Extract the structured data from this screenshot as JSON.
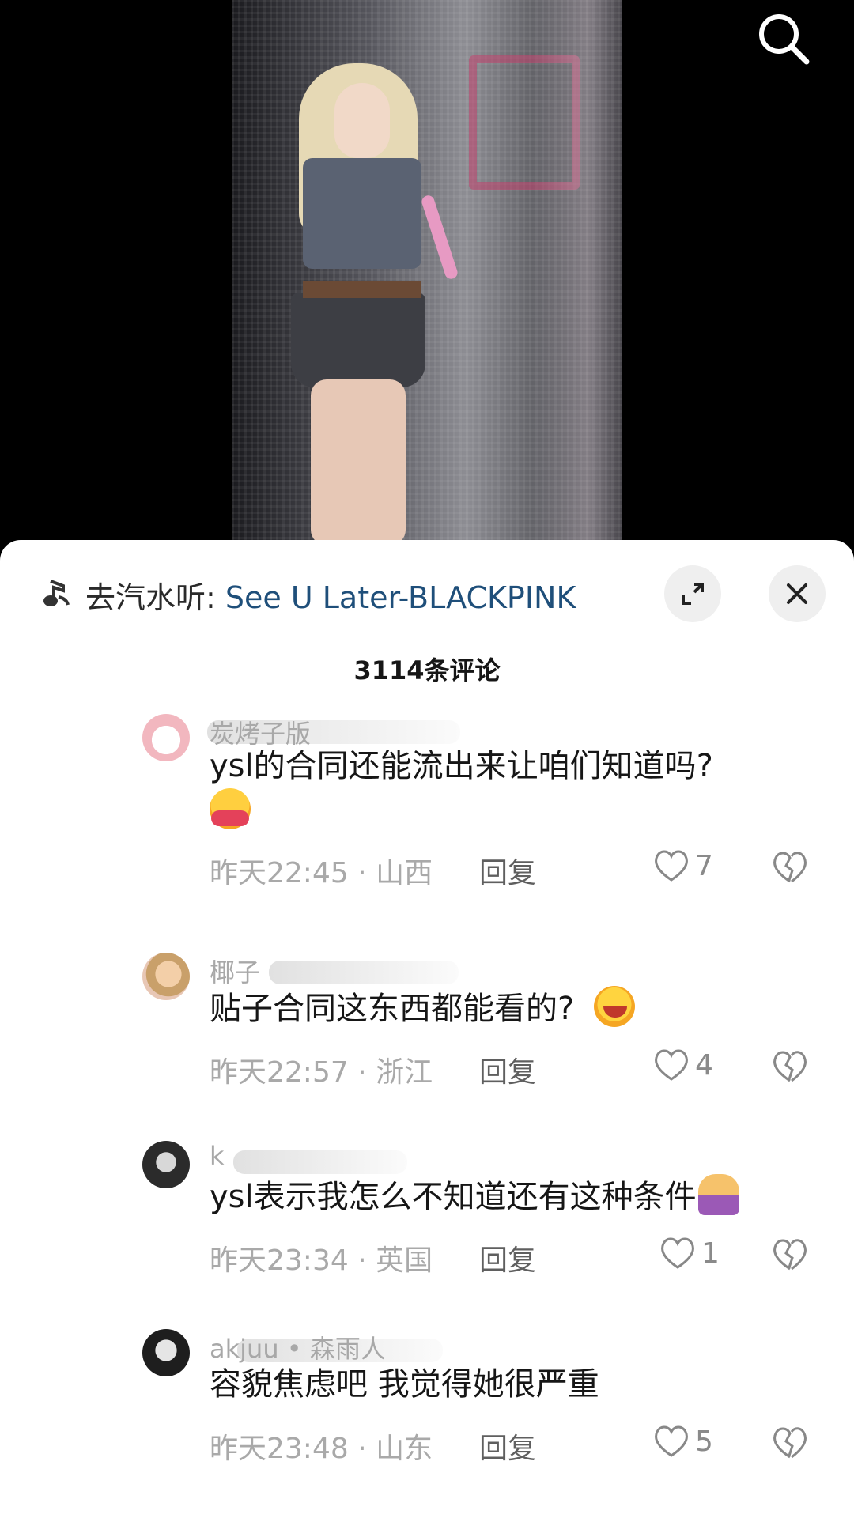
{
  "music": {
    "prefix": "去汽水听: ",
    "song": "See U Later-BLACKPINK"
  },
  "comments_count": "3114条评论",
  "comments": [
    {
      "username": "炭烤子版",
      "text_line1": "ysl的合同还能流出来让咱们知道吗?",
      "emoji": "hugging-face",
      "time_location": "昨天22:45 · 山西",
      "reply": "回复",
      "likes": "7"
    },
    {
      "username": "椰子",
      "text_line1": "贴子合同这东西都能看的?",
      "emoji": "rolling-laughing-face",
      "time_location": "昨天22:57 · 浙江",
      "reply": "回复",
      "likes": "4"
    },
    {
      "username": "k",
      "text_line1": "ysl表示我怎么不知道还有这种条件",
      "emoji": "person-shrugging",
      "time_location": "昨天23:34 · 英国",
      "reply": "回复",
      "likes": "1"
    },
    {
      "username": "akjuu • 森雨人",
      "text_line1": "容貌焦虑吧 我觉得她很严重",
      "time_location": "昨天23:48 · 山东",
      "reply": "回复",
      "likes": "5"
    }
  ],
  "colors": {
    "accent_song": "#1f4f7a",
    "meta_gray": "#a9a9a9"
  }
}
